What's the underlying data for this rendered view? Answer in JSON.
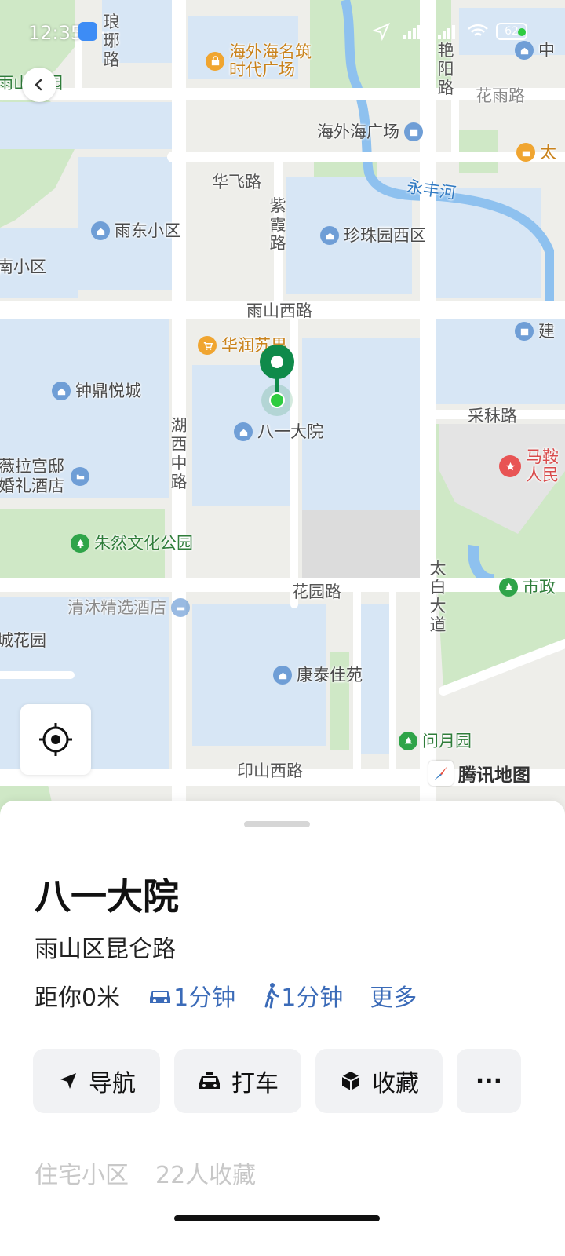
{
  "status_bar": {
    "time": "12:35",
    "dots": "..",
    "battery": "62"
  },
  "map": {
    "labels": {
      "langya_road": "琅琊路",
      "haiwaihai_mingzhu": "海外海名筑",
      "shidai_square": "时代广场",
      "yanyang_road": "艳阳路",
      "zhong_edge": "中",
      "yushan_park_edge": "雨山公园",
      "huayu_road": "花雨路",
      "haiwaihai_square": "海外海广场",
      "tai_edge": "太",
      "huafei_road": "华飞路",
      "yongfeng_river": "永丰河",
      "zixia_road": "紫霞路",
      "yudong_community": "雨东小区",
      "zhenzhuyuan_west": "珍珠园西区",
      "nan_community_edge": "南小区",
      "yushan_west_road": "雨山西路",
      "jian_edge": "建",
      "huarun_shop": "华润苏果",
      "zhongding_yuecheng": "钟鼎悦城",
      "caifu_road": "采秣路",
      "hunan_middle_road": "湖西中路",
      "bayi_dayuan": "八一大院",
      "ma_edge": "马鞍",
      "ren_edge": "人民",
      "weilagongdi": "薇拉宫邸",
      "wedding_hotel": "婚礼酒店",
      "zhuran_park": "朱然文化公园",
      "taibai_avenue": "太白大道",
      "shi_edge": "市政",
      "huayuan_road": "花园路",
      "qingmu_hotel": "清沐精选酒店",
      "chenghuayuan_edge": "城花园",
      "kangtai_jiayuan": "康泰佳苑",
      "wenyueyuan": "问月园",
      "yinshan_west_road": "印山西路"
    },
    "logo_text": "腾讯地图",
    "colors": {
      "block": "#d7e6f5",
      "park": "#cfe8c6",
      "water": "#8ec1ef",
      "road": "#ffffff",
      "ground": "#eeeeea",
      "marker": "#0f8a4a",
      "accent": "#3b6bb8"
    }
  },
  "place": {
    "title": "八一大院",
    "address": "雨山区昆仑路",
    "distance": "距你0米",
    "drive_time": "1分钟",
    "walk_time": "1分钟",
    "more": "更多",
    "tags": [
      "住宅小区",
      "22人收藏"
    ]
  },
  "actions": {
    "navigate": "导航",
    "taxi": "打车",
    "favorite": "收藏",
    "more": "···"
  }
}
